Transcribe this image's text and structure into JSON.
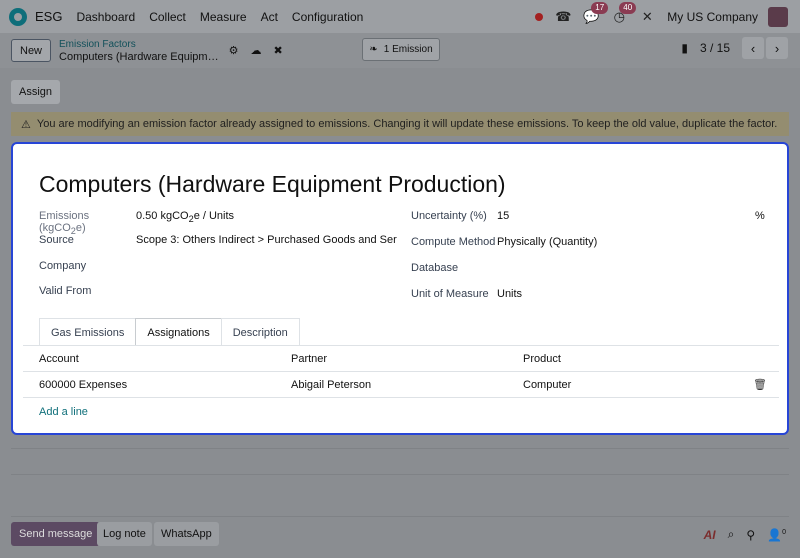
{
  "navbar": {
    "app_name": "ESG",
    "menu": [
      "Dashboard",
      "Collect",
      "Measure",
      "Act",
      "Configuration"
    ],
    "activity_badge": "17",
    "messages_badge": "40",
    "company": "My US Company"
  },
  "control_panel": {
    "new_label": "New",
    "breadcrumb_parent": "Emission Factors",
    "breadcrumb_current": "Computers (Hardware Equipm…",
    "smart_button_label": "1 Emission",
    "pager_value": "3 / 15"
  },
  "assign_label": "Assign",
  "warning_text": "You are modifying an emission factor already assigned to emissions. Changing it will update these emissions. To keep the old value, duplicate the factor.",
  "form": {
    "title": "Computers (Hardware Equipment Production)",
    "emissions_label_main": "Emissions (kgCO",
    "emissions_label_sub": "2",
    "emissions_label_end": "e)",
    "emissions_value_main": "0.50 kgCO",
    "emissions_value_sub": "2",
    "emissions_value_end": "e / Units",
    "source_label": "Source",
    "source_value": "Scope 3: Others Indirect > Purchased Goods and Ser",
    "company_label": "Company",
    "valid_from_label": "Valid From",
    "uncertainty_label": "Uncertainty (%)",
    "uncertainty_value": "15",
    "uncertainty_unit": "%",
    "compute_method_label": "Compute Method",
    "compute_method_value": "Physically (Quantity)",
    "database_label": "Database",
    "uom_label": "Unit of Measure",
    "uom_value": "Units"
  },
  "tabs": [
    "Gas Emissions",
    "Assignations",
    "Description"
  ],
  "table": {
    "headers": [
      "Account",
      "Partner",
      "Product"
    ],
    "rows": [
      {
        "account": "600000 Expenses",
        "partner": "Abigail Peterson",
        "product": "Computer"
      }
    ],
    "add_line": "Add a line"
  },
  "chatter": {
    "send_message": "Send message",
    "log_note": "Log note",
    "whatsapp": "WhatsApp",
    "ai_label": "AI",
    "followers_count": "0"
  }
}
